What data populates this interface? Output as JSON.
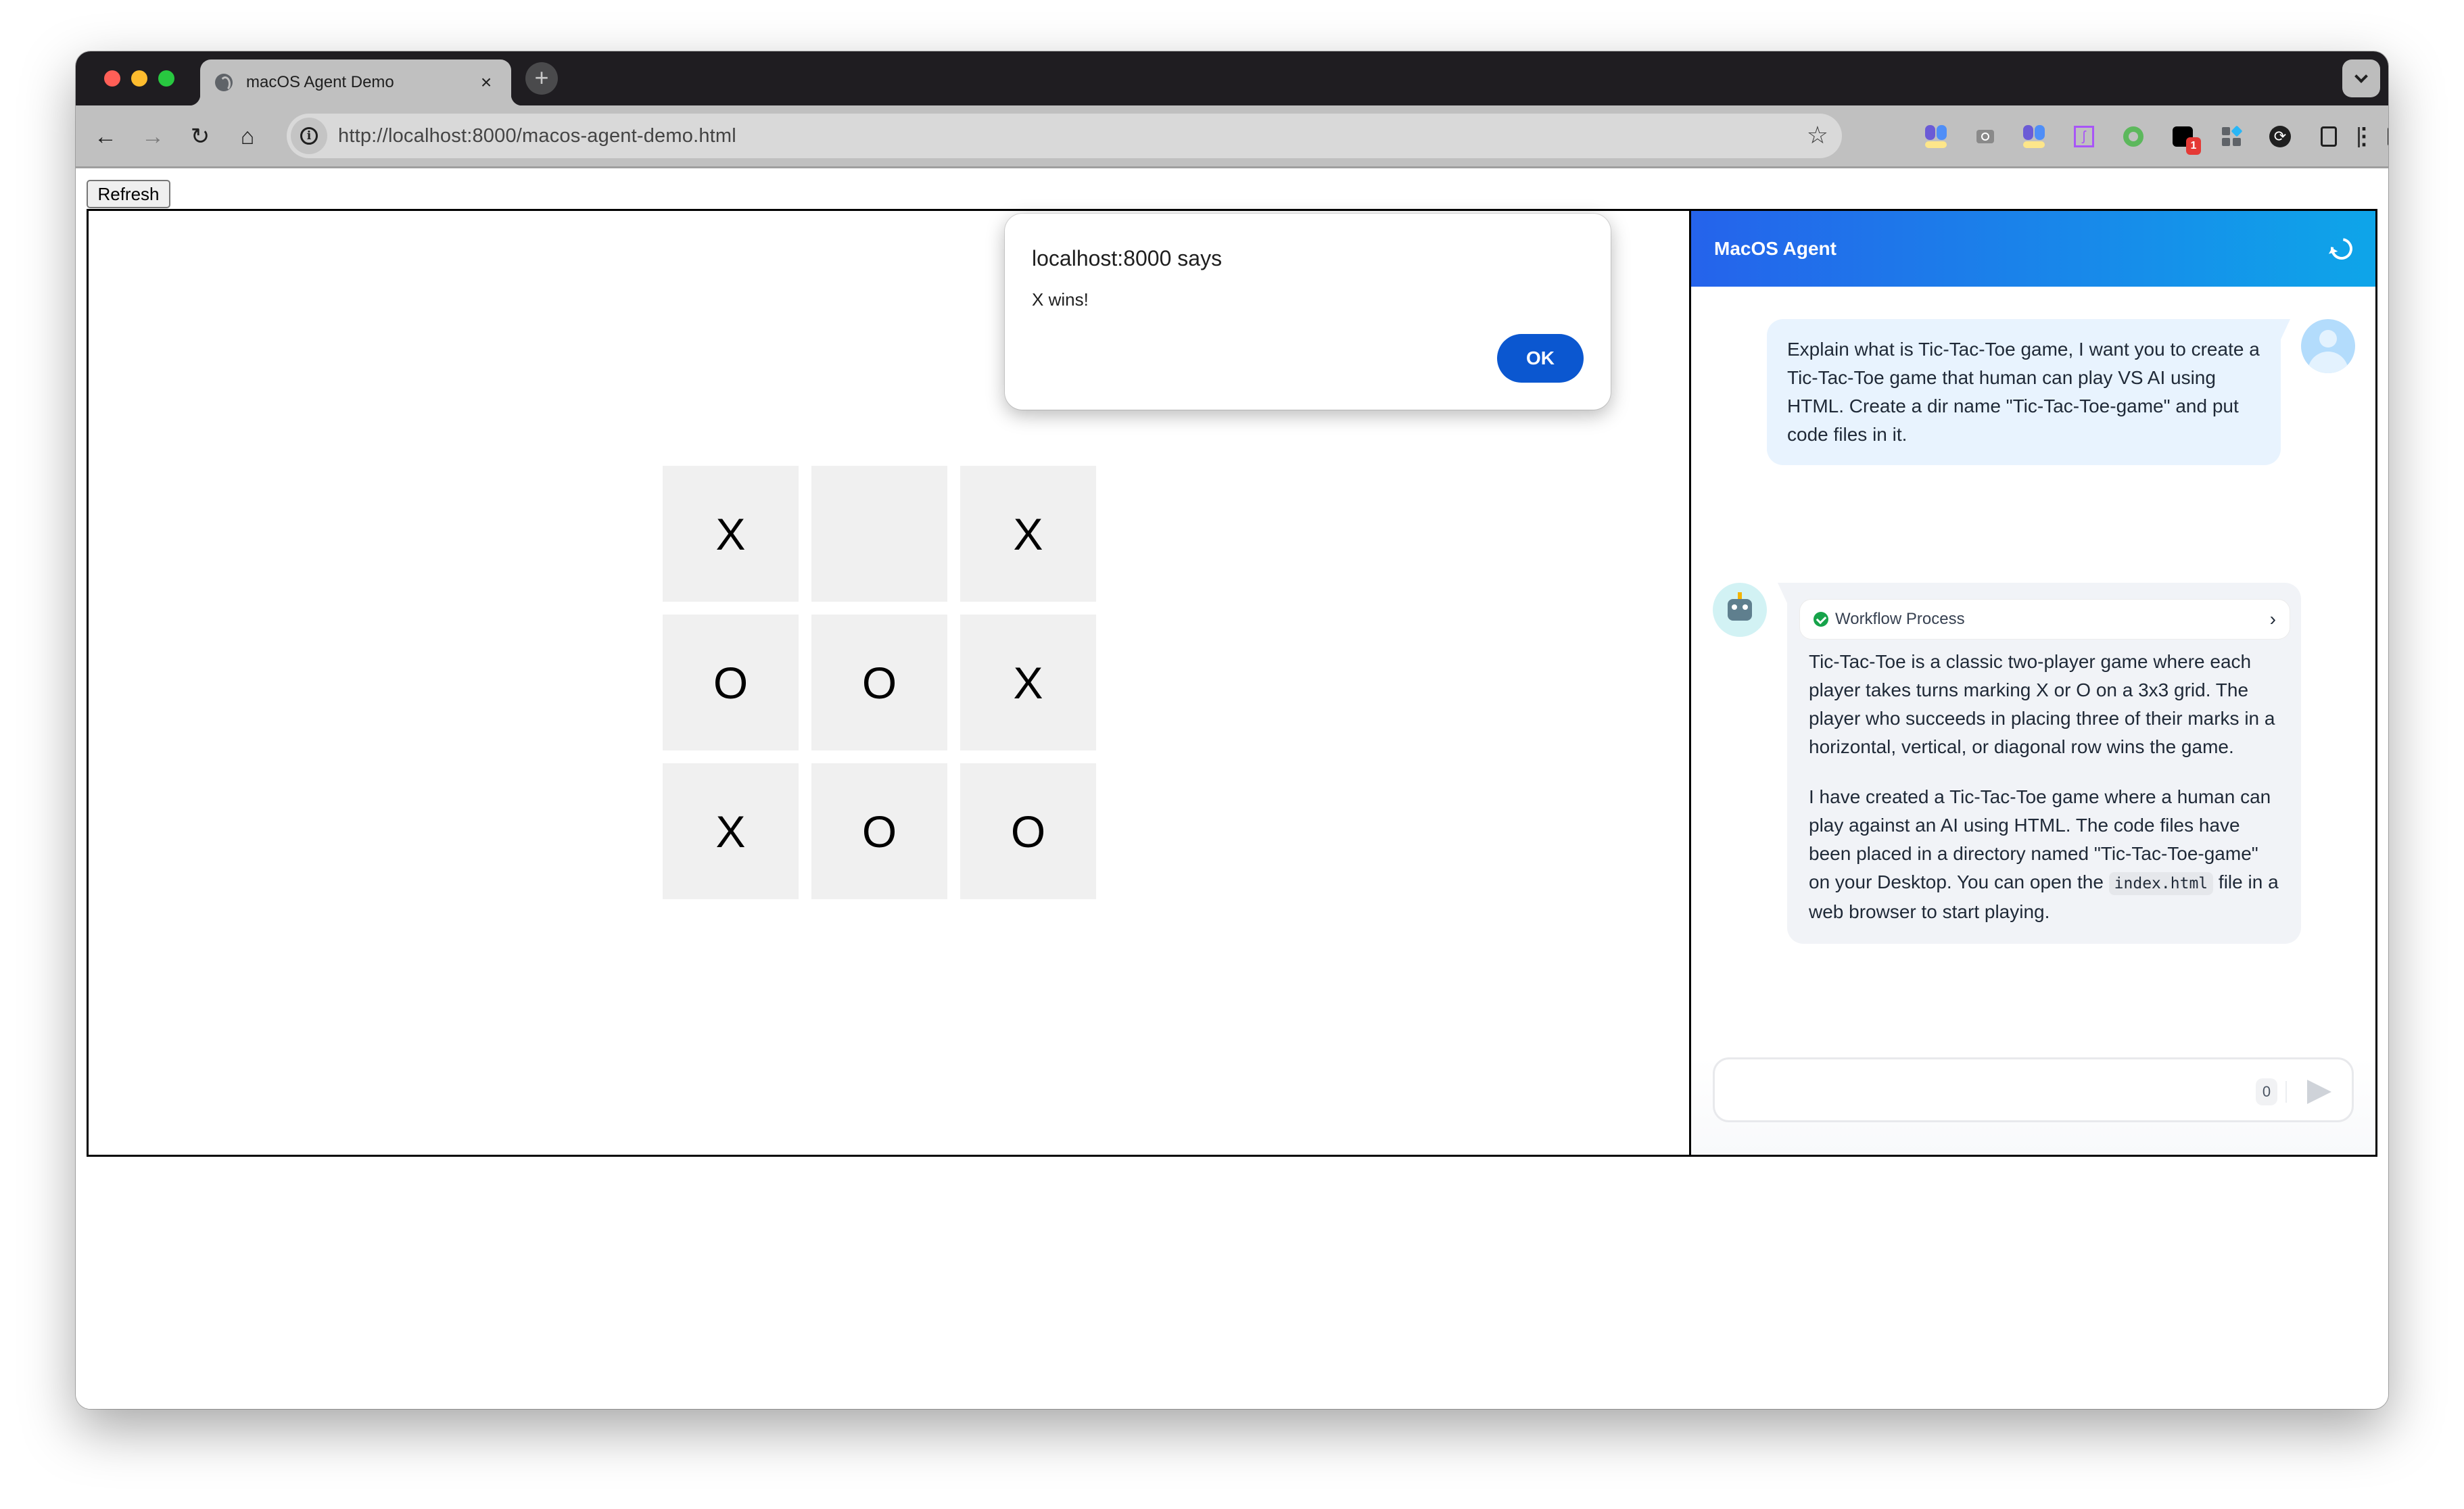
{
  "browser": {
    "tab_title": "macOS Agent Demo",
    "tab_close": "×",
    "new_tab": "+",
    "url": "http://localhost:8000/macos-agent-demo.html",
    "extension_badge": "1",
    "menu": "⋮",
    "nav": {
      "back": "←",
      "forward": "→",
      "reload": "↻",
      "home": "⌂",
      "star": "☆"
    }
  },
  "page": {
    "refresh_label": "Refresh"
  },
  "game": {
    "board": [
      [
        "X",
        "",
        "X"
      ],
      [
        "O",
        "O",
        "X"
      ],
      [
        "X",
        "O",
        "O"
      ]
    ]
  },
  "chat": {
    "title": "MacOS Agent",
    "user_message": "Explain what is Tic-Tac-Toe game, I want you to create a Tic-Tac-Toe game that human can play VS AI using HTML. Create a dir name \"Tic-Tac-Toe-game\" and put code files in it.",
    "workflow_label": "Workflow Process",
    "workflow_chevron": "›",
    "bot_paragraph_1": "Tic-Tac-Toe is a classic two-player game where each player takes turns marking X or O on a 3x3 grid. The player who succeeds in placing three of their marks in a horizontal, vertical, or diagonal row wins the game.",
    "bot_paragraph_2_before": "I have created a Tic-Tac-Toe game where a human can play against an AI using HTML. The code files have been placed in a directory named \"Tic-Tac-Toe-game\" on your Desktop. You can open the ",
    "bot_paragraph_2_code": "index.html",
    "bot_paragraph_2_after": " file in a web browser to start playing.",
    "input_value": "",
    "input_placeholder": "",
    "char_count": "0"
  },
  "dialog": {
    "title": "localhost:8000 says",
    "message": "X wins!",
    "ok_label": "OK"
  },
  "colors": {
    "header_gradient_start": "#2563eb",
    "header_gradient_end": "#0ea5e9",
    "dialog_button": "#0b57d0",
    "cell_background": "#f0f0f0"
  }
}
